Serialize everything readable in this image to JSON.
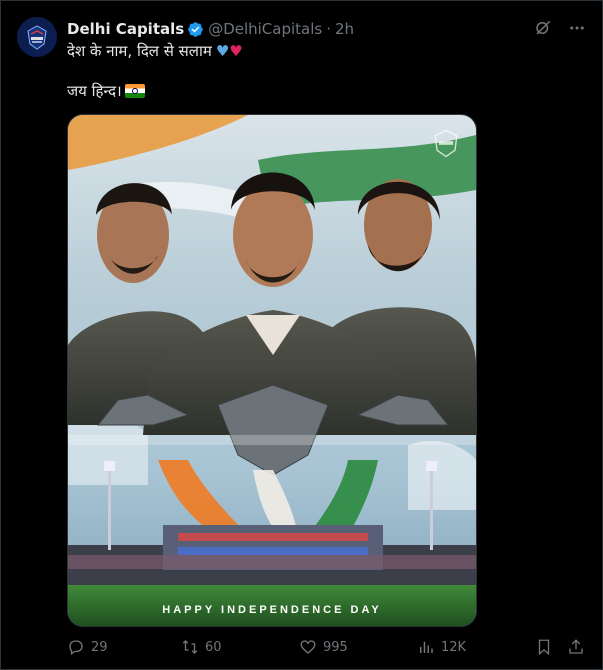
{
  "tweet": {
    "author_name": "Delhi Capitals",
    "handle": "@DelhiCapitals",
    "separator": "·",
    "time": "2h",
    "text_line1": "देश के नाम, दिल से सलाम",
    "text_line2": "जय हिन्द।",
    "heart_blue": "♥",
    "heart_red": "♥"
  },
  "media": {
    "caption": "HAPPY INDEPENDENCE DAY",
    "watermark_text": "DELHI CAPITALS"
  },
  "actions": {
    "replies": "29",
    "reposts": "60",
    "likes": "995",
    "views": "12K"
  },
  "colors": {
    "background": "#000000",
    "text": "#e7e9ea",
    "muted": "#71767b",
    "verified": "#1d9bf0",
    "saffron": "#ff9933",
    "green": "#138808"
  },
  "icons": {
    "verified": "verified-badge-icon",
    "grok": "grok-icon",
    "more": "more-icon",
    "reply": "reply-icon",
    "repost": "repost-icon",
    "like": "like-icon",
    "views": "views-icon",
    "bookmark": "bookmark-icon",
    "share": "share-icon"
  }
}
